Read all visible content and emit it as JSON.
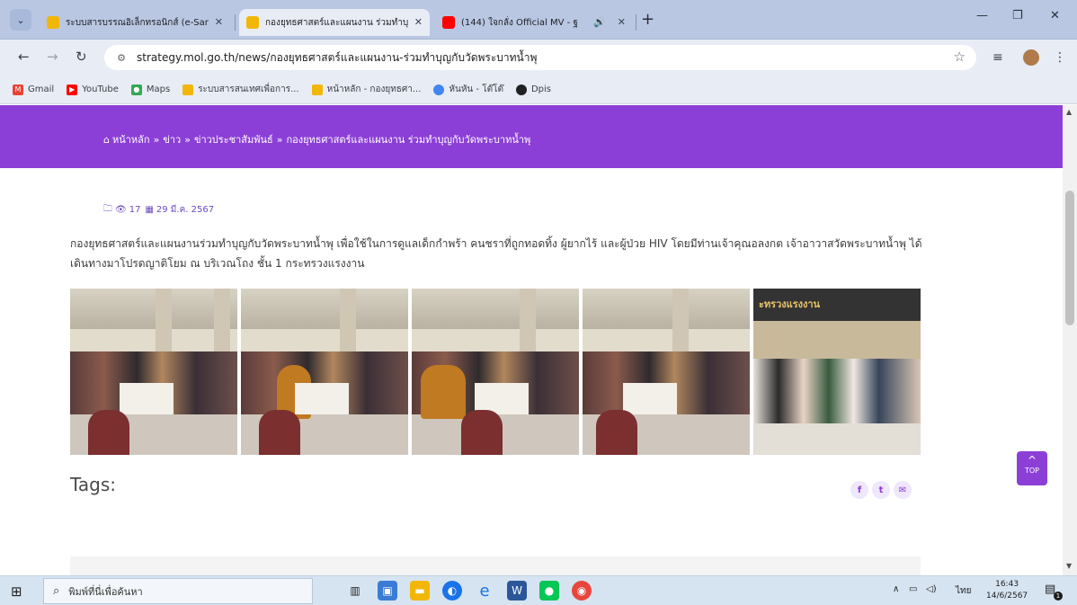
{
  "browser": {
    "tabs": [
      {
        "title": "ระบบสารบรรณอิเล็กทรอนิกส์ (e-Sar",
        "favicon_color": "#f2b705",
        "active": false
      },
      {
        "title": "กองยุทธศาสตร์และแผนงาน ร่วมทำบุ",
        "favicon_color": "#f2b705",
        "active": true
      },
      {
        "title": "(144) ใจกลั่ง Official MV - ฐ",
        "favicon_color": "#ff0000",
        "active": false
      }
    ],
    "tab_close": "✕",
    "new_tab": "+",
    "window_controls": {
      "minimize": "—",
      "restore": "❐",
      "close": "✕"
    },
    "url": "strategy.mol.go.th/news/กองยุทธศาสตร์และแผนงาน-ร่วมทำบุญกับวัดพระบาทน้ำพุ",
    "bookmarks": [
      {
        "label": "Gmail",
        "icon": "gmail-icon",
        "color": "#ea4335"
      },
      {
        "label": "YouTube",
        "icon": "youtube-icon",
        "color": "#ff0000"
      },
      {
        "label": "Maps",
        "icon": "maps-icon",
        "color": "#34a853"
      },
      {
        "label": "ระบบสารสนเทศเพื่อการ...",
        "icon": "folder-icon",
        "color": "#f2b705"
      },
      {
        "label": "หน้าหลัก - กองยุทธศา...",
        "icon": "folder-icon",
        "color": "#f2b705"
      },
      {
        "label": "หันหัน - โต๊โต๊",
        "icon": "globe-icon",
        "color": "#4285f4"
      },
      {
        "label": "Dpis",
        "icon": "globe-icon",
        "color": "#202124"
      }
    ]
  },
  "page": {
    "accent": "#8c3fd6",
    "breadcrumb": [
      "หน้าหลัก",
      "ข่าว",
      "ข่าวประชาสัมพันธ์",
      "กองยุทธศาสตร์และแผนงาน ร่วมทำบุญกับวัดพระบาทน้ำพุ"
    ],
    "breadcrumb_sep": "»",
    "views": "17",
    "date": "29 มี.ค. 2567",
    "article_text": "กองยุทธศาสตร์และแผนงานร่วมทำบุญกับวัดพระบาทน้ำพุ เพื่อใช้ในการดูแลเด็กกำพร้า คนชราที่ถูกทอดทิ้ง ผู้ยากไร้ และผู้ป่วย HIV โดยมีท่านเจ้าคุณอลงกต เจ้าอาวาสวัดพระบาทน้ำพุ ได้เดินทางมาโปรดญาติโยม ณ บริเวณโถง ชั้น 1 กระทรวงแรงงาน",
    "group_photo_sign": "ะทรวงแรงงาน",
    "tags_label": "Tags:",
    "share": [
      "f",
      "t",
      "✉"
    ],
    "top_button": "TOP"
  },
  "taskbar": {
    "search_placeholder": "พิมพ์ที่นี่เพื่อค้นหา",
    "lang": "ไทย",
    "time": "16:43",
    "date": "14/6/2567",
    "notification_count": "1"
  }
}
